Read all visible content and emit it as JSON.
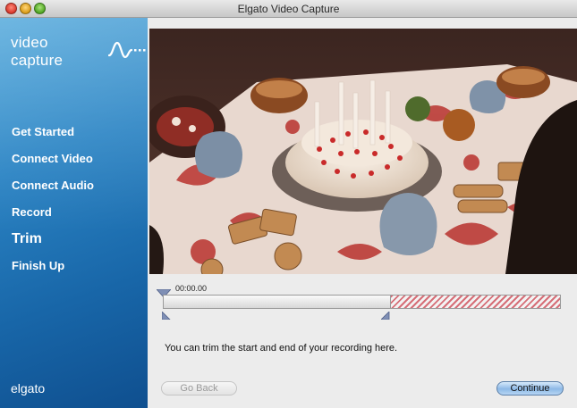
{
  "window": {
    "title": "Elgato Video Capture"
  },
  "sidebar": {
    "logo_text": "video capture",
    "items": [
      {
        "label": "Get Started"
      },
      {
        "label": "Connect Video"
      },
      {
        "label": "Connect Audio"
      },
      {
        "label": "Record"
      },
      {
        "label": "Trim",
        "active": true
      },
      {
        "label": "Finish Up"
      }
    ],
    "brand": "elgato"
  },
  "timeline": {
    "timecode": "00:00.00"
  },
  "main": {
    "hint": "You can trim the start and end of your recording here."
  },
  "buttons": {
    "back_label": "Go Back",
    "continue_label": "Continue"
  },
  "colors": {
    "sidebar_blue": "#1866a8",
    "trim_stripe": "#d66e77"
  }
}
